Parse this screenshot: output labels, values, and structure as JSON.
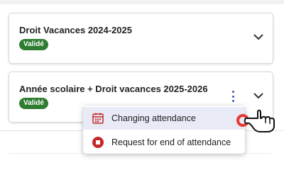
{
  "cards": [
    {
      "title": "Droit Vacances 2024-2025",
      "status": "Validé"
    },
    {
      "title": "Année scolaire + Droit vacances 2025-2026",
      "status": "Validé"
    }
  ],
  "menu": {
    "items": [
      {
        "label": "Changing attendance",
        "icon": "calendar-icon"
      },
      {
        "label": "Request for end of attendance",
        "icon": "stop-circle-icon"
      }
    ]
  },
  "colors": {
    "badge": "#2e7d32",
    "accent": "#3f51b5",
    "highlight": "#e8eaf6",
    "danger": "#c62828"
  }
}
